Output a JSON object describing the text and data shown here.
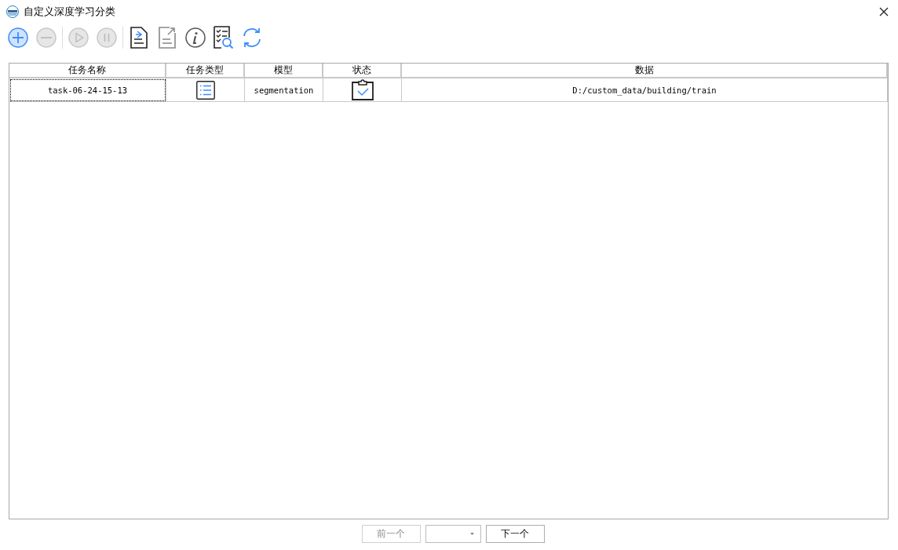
{
  "window": {
    "title": "自定义深度学习分类"
  },
  "toolbar": [
    {
      "kind": "add",
      "disabled": false
    },
    {
      "kind": "remove",
      "disabled": true
    },
    {
      "kind": "separator"
    },
    {
      "kind": "play",
      "disabled": true
    },
    {
      "kind": "pause",
      "disabled": true
    },
    {
      "kind": "separator"
    },
    {
      "kind": "import",
      "disabled": false
    },
    {
      "kind": "export",
      "disabled": true
    },
    {
      "kind": "info",
      "disabled": false
    },
    {
      "kind": "checklist",
      "disabled": false
    },
    {
      "kind": "refresh",
      "disabled": false
    }
  ],
  "table": {
    "columns": [
      "任务名称",
      "任务类型",
      "模型",
      "状态",
      "数据"
    ],
    "rows": [
      {
        "focused": true,
        "name": "task-06-24-15-13",
        "task_type": {
          "kind": "list"
        },
        "model": "segmentation",
        "status": {
          "kind": "done"
        },
        "data": "D:/custom_data/building/train"
      }
    ]
  },
  "pager": {
    "prev": {
      "label": "前一个",
      "disabled": true
    },
    "next": {
      "label": "下一个",
      "disabled": false
    }
  }
}
